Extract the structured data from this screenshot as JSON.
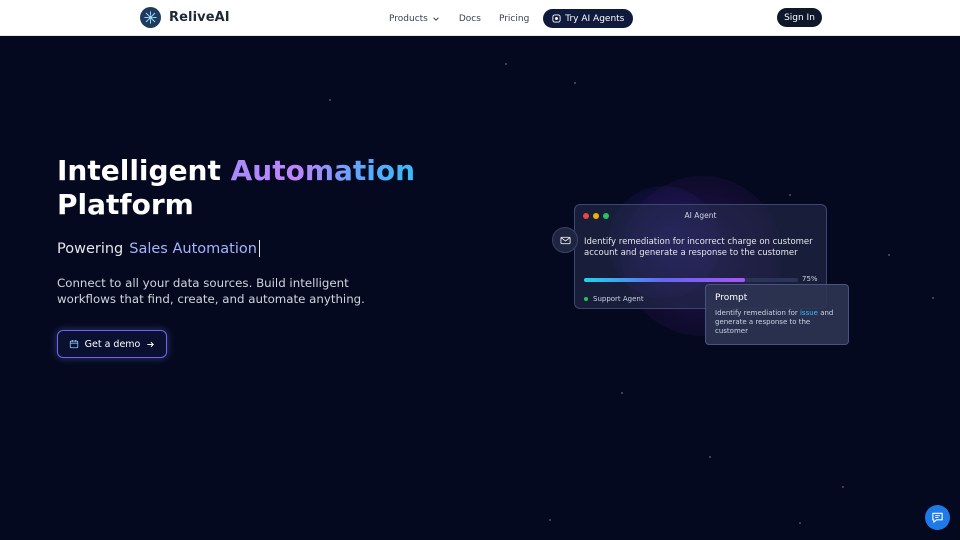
{
  "brand": {
    "name": "ReliveAI",
    "logo_icon": "brain-network-icon"
  },
  "nav": {
    "products": "Products",
    "docs": "Docs",
    "pricing": "Pricing",
    "try_agents": "Try AI Agents",
    "sign_in": "Sign In"
  },
  "hero": {
    "title_line1_a": "Intelligent",
    "title_line1_b": "Automation",
    "title_line2": "Platform",
    "powering_prefix": "Powering",
    "powering_highlight": "Sales Automation",
    "subtitle": "Connect to all your data sources. Build intelligent workflows that find, create, and automate anything.",
    "cta": "Get a demo"
  },
  "agent_card": {
    "title": "AI Agent",
    "text": "Identify remediation for incorrect charge on customer account and generate a response to the customer",
    "progress": 0.75,
    "progress_label": "75%",
    "agent_name": "Support Agent"
  },
  "prompt_card": {
    "title": "Prompt",
    "text_before": "Identify remediation for",
    "text_highlight": "issue",
    "text_after": "and generate a response to the customer"
  },
  "colors": {
    "background": "#050920",
    "accent_purple": "#a78bfa",
    "accent_blue": "#38bdf8",
    "chat_button": "#1d7ae6",
    "status_green": "#22c55e"
  }
}
